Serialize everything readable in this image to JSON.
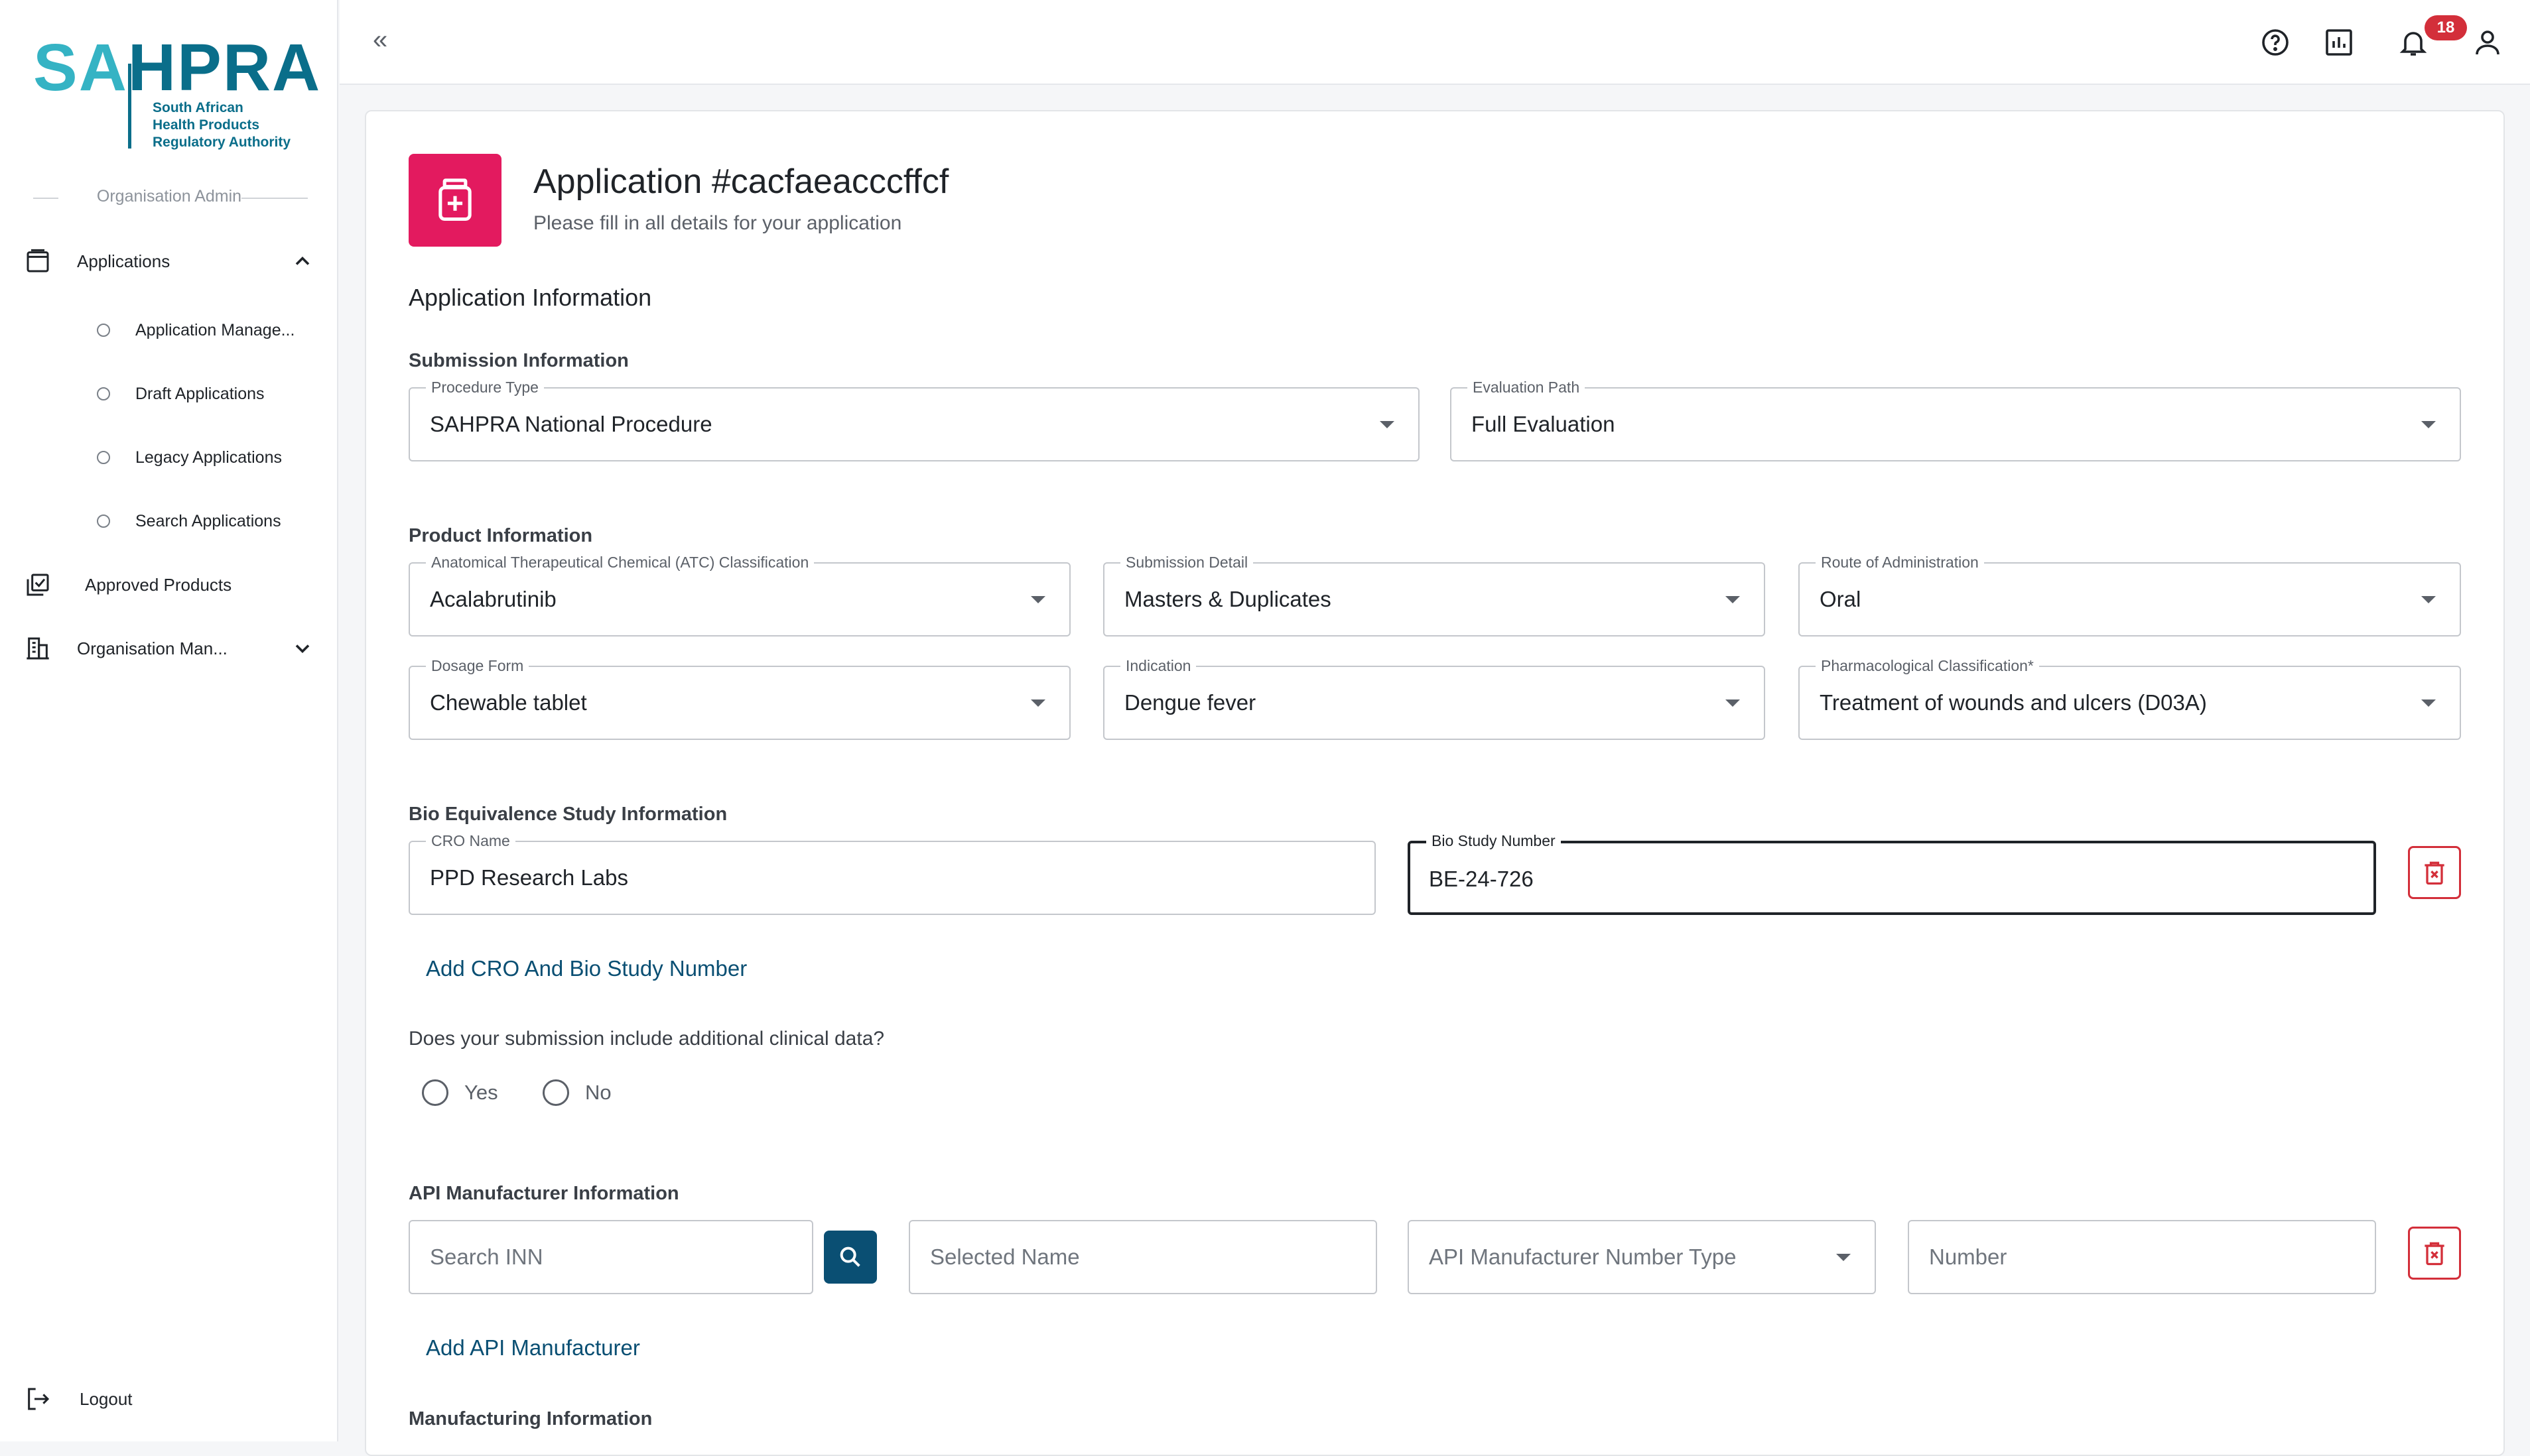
{
  "brand": {
    "logo_sa": "SA",
    "logo_hpra": "HPRA",
    "logo_sub_line1": "South African",
    "logo_sub_line2": "Health Products",
    "logo_sub_line3": "Regulatory Authority"
  },
  "sidebar": {
    "role_label": "Organisation Admin",
    "applications_label": "Applications",
    "sub_items": [
      {
        "label": "Application Manage..."
      },
      {
        "label": "Draft Applications"
      },
      {
        "label": "Legacy Applications"
      },
      {
        "label": "Search Applications"
      }
    ],
    "approved_products_label": "Approved Products",
    "organisation_label": "Organisation Man...",
    "logout_label": "Logout"
  },
  "topbar": {
    "collapse_glyph": "«",
    "notification_count": "18"
  },
  "header": {
    "title": "Application #cacfaeacccffcf",
    "subtitle": "Please fill in all details for your application"
  },
  "form": {
    "section_title": "Application Information",
    "submission": {
      "title": "Submission Information",
      "procedure_type": {
        "label": "Procedure Type",
        "value": "SAHPRA National Procedure"
      },
      "evaluation_path": {
        "label": "Evaluation Path",
        "value": "Full Evaluation"
      }
    },
    "product": {
      "title": "Product Information",
      "atc": {
        "label": "Anatomical Therapeutical Chemical (ATC) Classification",
        "value": "Acalabrutinib"
      },
      "submission_detail": {
        "label": "Submission Detail",
        "value": "Masters & Duplicates"
      },
      "route": {
        "label": "Route of Administration",
        "value": "Oral"
      },
      "dosage_form": {
        "label": "Dosage Form",
        "value": "Chewable tablet"
      },
      "indication": {
        "label": "Indication",
        "value": "Dengue fever"
      },
      "pharma_class": {
        "label": "Pharmacological Classification*",
        "value": "Treatment of wounds and ulcers (D03A)"
      }
    },
    "bio": {
      "title": "Bio Equivalence Study Information",
      "cro_name": {
        "label": "CRO Name",
        "value": "PPD Research Labs"
      },
      "bio_study_number": {
        "label": "Bio Study Number",
        "value": "BE-24-726"
      },
      "add_link": "Add CRO And Bio Study Number"
    },
    "clinical": {
      "question": "Does your submission include additional clinical data?",
      "yes_label": "Yes",
      "no_label": "No"
    },
    "api": {
      "title": "API Manufacturer Information",
      "search_inn_placeholder": "Search INN",
      "selected_name_placeholder": "Selected Name",
      "number_type_placeholder": "API Manufacturer Number Type",
      "number_placeholder": "Number",
      "add_link": "Add API Manufacturer"
    },
    "manufacturing": {
      "title": "Manufacturing Information"
    }
  },
  "colors": {
    "brand_teal": "#35b3c4",
    "brand_blue": "#0a6e8a",
    "accent_pink": "#e31a5f",
    "danger_red": "#d32f3a",
    "link_blue": "#0a4f73"
  }
}
